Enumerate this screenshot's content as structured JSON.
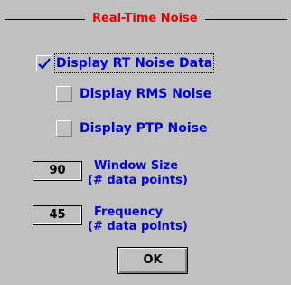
{
  "group": {
    "title": "Real-Time Noise",
    "title_color": "#e00000"
  },
  "options": [
    {
      "label": "Display RT Noise Data",
      "checked": true,
      "focused": true
    },
    {
      "label": "Display RMS Noise",
      "checked": false
    },
    {
      "label": "Display PTP Noise",
      "checked": false
    }
  ],
  "fields": [
    {
      "value": "90",
      "label_line1": "Window Size",
      "label_line2": "(# data points)"
    },
    {
      "value": "45",
      "label_line1": "Frequency",
      "label_line2": "(# data points)"
    }
  ],
  "ok_button": {
    "label": "OK"
  },
  "colors": {
    "label_blue": "#0000cc",
    "background": "#c0c0c0"
  }
}
